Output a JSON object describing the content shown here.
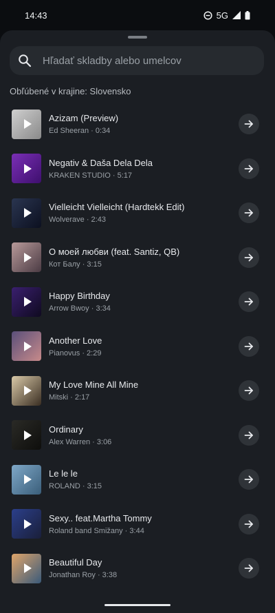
{
  "status": {
    "time": "14:43",
    "network": "5G"
  },
  "search": {
    "placeholder": "Hľadať skladby alebo umelcov"
  },
  "section_title": "Obľúbené v krajine: Slovensko",
  "tracks": [
    {
      "title": "Azizam (Preview)",
      "artist": "Ed Sheeran",
      "duration": "0:34",
      "color_a": "#cfcfcf",
      "color_b": "#8a8a8a"
    },
    {
      "title": "Negativ & Daša Dela Dela",
      "artist": "KRAKEN STUDIO",
      "duration": "5:17",
      "color_a": "#7a2fb5",
      "color_b": "#3e0f6e"
    },
    {
      "title": "Vielleicht Vielleicht (Hardtekk Edit)",
      "artist": "Wolverave",
      "duration": "2:43",
      "color_a": "#2a3550",
      "color_b": "#0c1020"
    },
    {
      "title": "О моей любви (feat. Santiz, QB)",
      "artist": "Кот Балу",
      "duration": "3:15",
      "color_a": "#b89a9a",
      "color_b": "#4b3b44"
    },
    {
      "title": "Happy Birthday",
      "artist": "Arrow Bwoy",
      "duration": "3:34",
      "color_a": "#3a1f6e",
      "color_b": "#0f0a20"
    },
    {
      "title": "Another Love",
      "artist": "Pianovus",
      "duration": "2:29",
      "color_a": "#5a4f7a",
      "color_b": "#c78a8a"
    },
    {
      "title": "My Love Mine All Mine",
      "artist": "Mitski",
      "duration": "2:17",
      "color_a": "#d9c9a8",
      "color_b": "#3a2e22"
    },
    {
      "title": "Ordinary",
      "artist": "Alex Warren",
      "duration": "3:06",
      "color_a": "#2a2a26",
      "color_b": "#0e0e0c"
    },
    {
      "title": "Le le le",
      "artist": "ROLAND",
      "duration": "3:15",
      "color_a": "#7fa8c8",
      "color_b": "#3a5e7a"
    },
    {
      "title": "Sexy.. feat.Martha Tommy",
      "artist": "Roland band Smižany",
      "duration": "3:44",
      "color_a": "#2b3f8a",
      "color_b": "#1a1f3a"
    },
    {
      "title": "Beautiful Day",
      "artist": "Jonathan Roy",
      "duration": "3:38",
      "color_a": "#e0a56a",
      "color_b": "#3a5a7a"
    }
  ],
  "colors": {
    "sheet": "#1b1e23",
    "search_bg": "#262a2f",
    "button_bg": "#2f3338"
  },
  "icons": {
    "search": "search-icon",
    "arrow": "arrow-right-icon"
  }
}
